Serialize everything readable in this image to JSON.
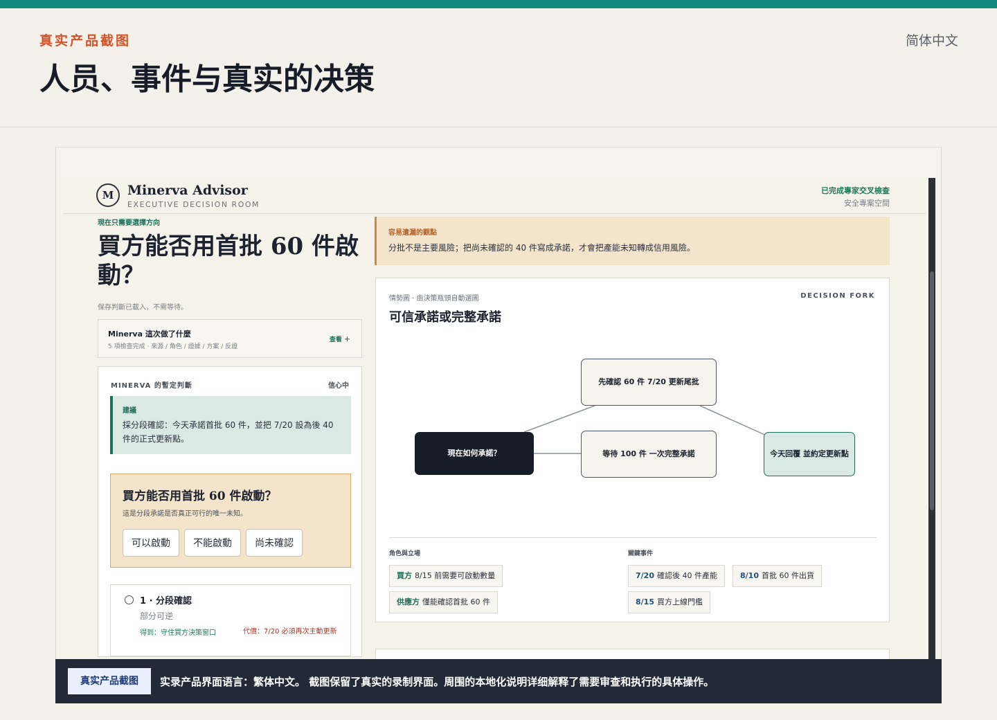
{
  "page": {
    "eyebrow": "真实产品截图",
    "title": "人员、事件与真实的决策",
    "language": "简体中文"
  },
  "app": {
    "brand_initial": "M",
    "brand_name": "Minerva Advisor",
    "brand_sub": "EXECUTIVE DECISION ROOM",
    "status": "已完成專家交叉檢查",
    "space": "安全專案空間"
  },
  "left": {
    "kicker": "現在只需要選擇方向",
    "question": "買方能否用首批 60 件啟動？",
    "saved_note": "保存判斷已載入，不需等待。",
    "did": {
      "title": "Minerva 這次做了什麼",
      "sub": "5 項檢查完成 · 來源 / 角色 / 證據 / 方案 / 反證",
      "link": "查看 ＋"
    },
    "verdict": {
      "head": "MINERVA 的暫定判斷",
      "confidence": "信心中",
      "advice_tag": "建議",
      "advice_text": "採分段確認：今天承諾首批 60 件，並把 7/20 設為後 40 件的正式更新點。"
    },
    "ask": {
      "title": "買方能否用首批 60 件啟動？",
      "sub": "這是分段承諾是否真正可行的唯一未知。",
      "buttons": [
        "可以啟動",
        "不能啟動",
        "尚未確認"
      ]
    },
    "option": {
      "title": "1 · 分段確認",
      "sub": "部分可逆",
      "gain": "得到：守住買方決策窗口",
      "cost": "代價：7/20 必須再次主動更新"
    }
  },
  "warning": {
    "tag": "容易遺漏的觀點",
    "text": "分批不是主要風險；把尚未確認的 40 件寫成承諾，才會把產能未知轉成信用風險。"
  },
  "fork": {
    "kicker": "情勢圖 · 由決策瓶頸自動選圖",
    "label": "DECISION FORK",
    "title": "可信承諾或完整承諾",
    "nodes": {
      "now": "現在如何承諾？",
      "a": "先確認 60 件 7/20 更新尾批",
      "b": "等待 100 件 一次完整承諾",
      "c": "今天回覆 並約定更新點"
    },
    "roles_label": "角色與立場",
    "roles": [
      {
        "who": "買方",
        "text": "8/15 前需要可啟動數量"
      },
      {
        "who": "供應方",
        "text": "僅能確認首批 60 件"
      }
    ],
    "events_label": "關鍵事件",
    "events": [
      {
        "date": "7/20",
        "text": "確認後 40 件產能"
      },
      {
        "date": "8/10",
        "text": "首批 60 件出貨"
      },
      {
        "date": "8/15",
        "text": "買方上線門檻"
      }
    ]
  },
  "caption": {
    "badge": "真实产品截图",
    "text": "实录产品界面语言：繁体中文。 截图保留了真实的录制界面。周围的本地化说明详细解释了需要审查和执行的具体操作。"
  },
  "colors": {
    "accent": "#138a80",
    "eyebrow": "#d2522a",
    "dark": "#161c28",
    "green": "#1f6f5a",
    "warm": "#f3e4cb"
  }
}
